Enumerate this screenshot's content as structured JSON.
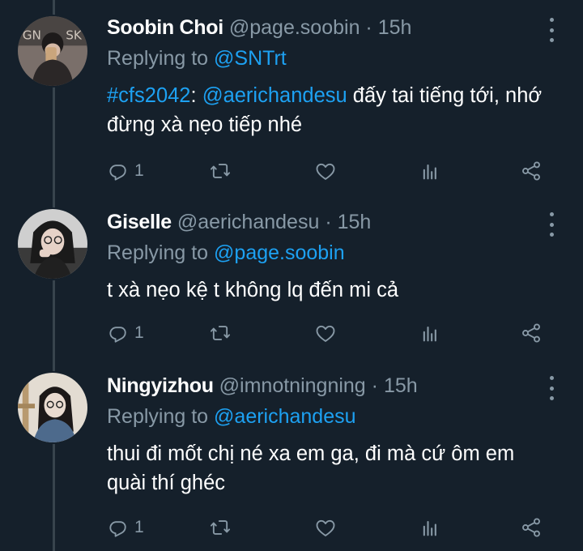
{
  "colors": {
    "background": "#15202b",
    "link": "#1da1f2",
    "muted": "#8899a6",
    "text": "#ffffff"
  },
  "icons": {
    "reply": "reply-icon",
    "retweet": "retweet-icon",
    "like": "heart-icon",
    "analytics": "analytics-icon",
    "share": "share-icon",
    "more": "more-icon"
  },
  "tweets": [
    {
      "name": "Soobin Choi",
      "handle": "@page.soobin",
      "separator": "·",
      "time": "15h",
      "replying_prefix": "Replying to",
      "replying_to": "@SNTrt",
      "hashtag": "#cfs2042",
      "colon": ":",
      "mention": "@aerichandesu",
      "text_after": " đấy tai tiếng tới, nhớ đừng xà nẹo tiếp nhé",
      "reply_count": "1"
    },
    {
      "name": "Giselle",
      "handle": "@aerichandesu",
      "separator": "·",
      "time": "15h",
      "replying_prefix": "Replying to",
      "replying_to": "@page.soobin",
      "text": "t xà nẹo kệ t không lq đến mi cả",
      "reply_count": "1"
    },
    {
      "name": "Ningyizhou",
      "handle": "@imnotningning",
      "separator": "·",
      "time": "15h",
      "replying_prefix": "Replying to",
      "replying_to": "@aerichandesu",
      "text": "thui đi mốt chị né xa em ga, đi mà cứ ôm em quài thí ghéc",
      "reply_count": "1"
    }
  ]
}
